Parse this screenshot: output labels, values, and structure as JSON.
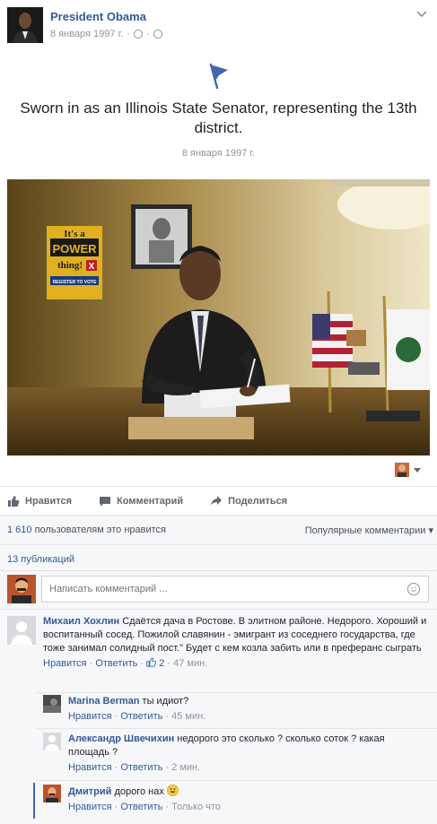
{
  "post": {
    "author": "President Obama",
    "date": "8 января 1997 г.",
    "title": "Sworn in as an Illinois State Senator, representing the 13th district.",
    "event_date": "8 января 1997 г.",
    "photo_sign_lines": [
      "It's a",
      "POWER",
      "thing!",
      "X",
      "REGISTER TO VOTE"
    ]
  },
  "actions": {
    "like": "Нравится",
    "comment": "Комментарий",
    "share": "Поделиться"
  },
  "summary": {
    "likes_number": "1 610",
    "likes_rest": "пользователям это нравится",
    "sort_label": "Популярные комментарии",
    "publications": "13 публикаций"
  },
  "composer": {
    "placeholder": "Написать комментарий ..."
  },
  "comments": [
    {
      "author": "Михаил Хохлин",
      "text": "Сдаётся дача в Ростове. В элитном районе. Недорого. Хороший и воспитанный сосед. Пожилой славянин - эмигрант из соседнего государства, где тоже занимал солидный пост.\" Будет с кем козла забить или в преферанс сыграть",
      "like_label": "Нравится",
      "reply_label": "Ответить",
      "likes": "2",
      "time": "47 мин.",
      "replies": [
        {
          "author": "Marina Berman",
          "text": "ты идиот?",
          "like_label": "Нравится",
          "reply_label": "Ответить",
          "time": "45 мин."
        },
        {
          "author": "Александр Швечихин",
          "text": "недорого это сколько ? сколько соток ? какая площадь ?",
          "like_label": "Нравится",
          "reply_label": "Ответить",
          "time": "2 мин."
        },
        {
          "author": "Дмитрий",
          "text": "дорого нах",
          "like_label": "Нравится",
          "reply_label": "Ответить",
          "time": "Только что"
        }
      ]
    }
  ],
  "colors": {
    "link": "#365899",
    "muted": "#90949c",
    "accent": "#4267b2"
  }
}
